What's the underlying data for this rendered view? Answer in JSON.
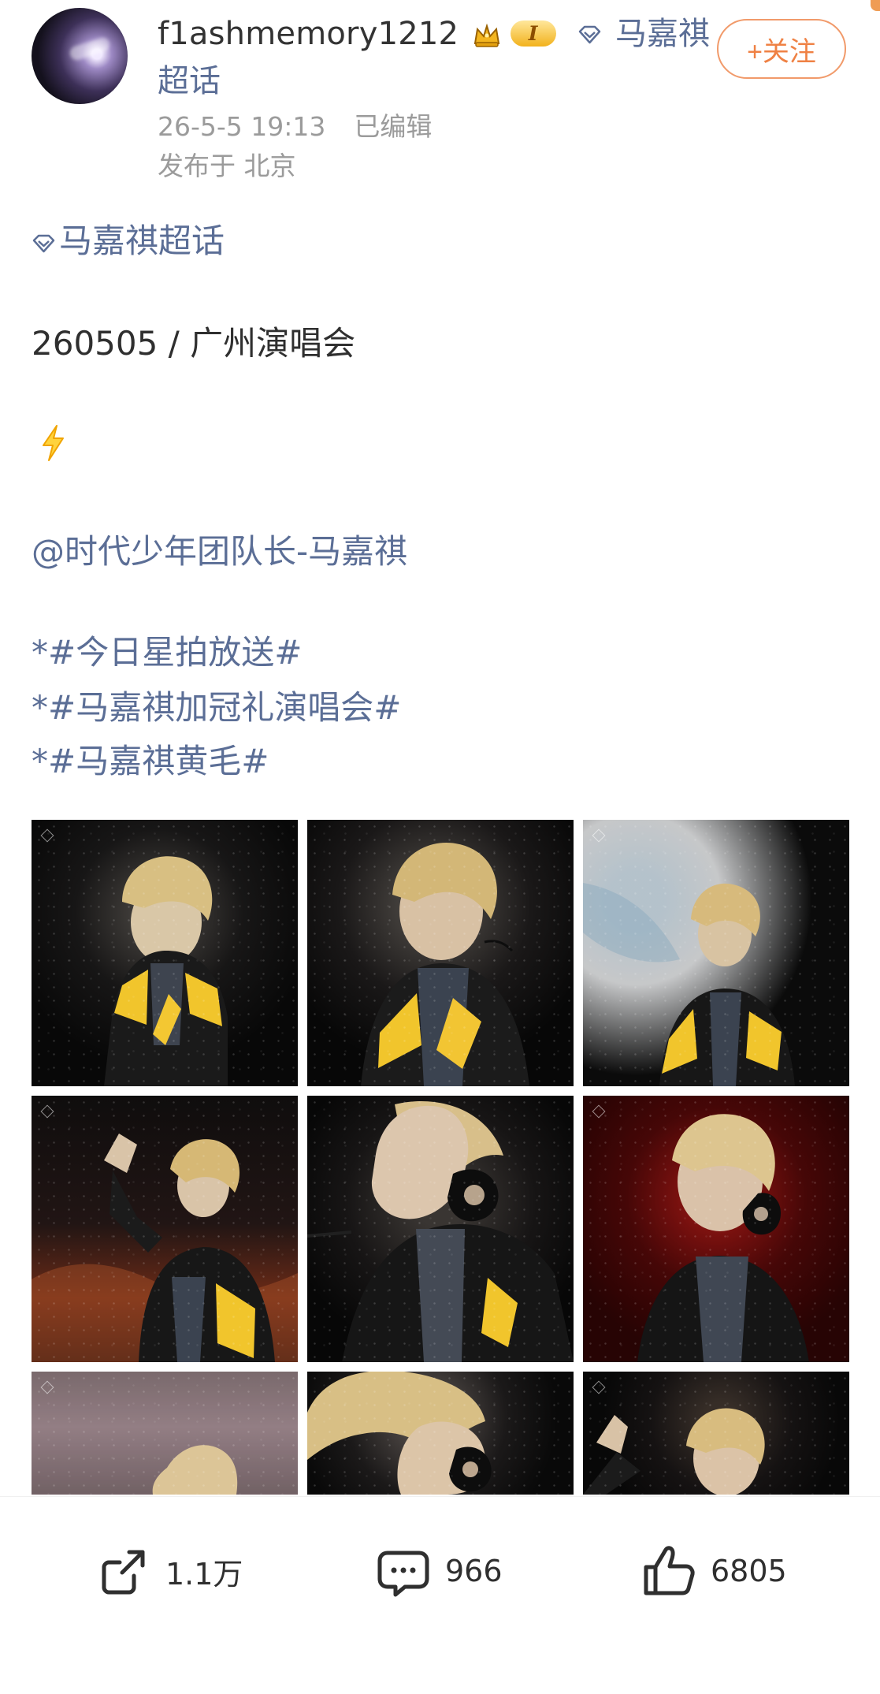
{
  "header": {
    "username": "f1ashmemory1212",
    "level_badge": "I",
    "supertopic_name_line1": "马嘉祺",
    "supertopic_name_line2": "超话",
    "follow_label": "+关注",
    "timestamp": "26-5-5 19:13",
    "edited_label": "已编辑",
    "location": "发布于 北京"
  },
  "post": {
    "topic": "马嘉祺超话",
    "date_line": "260505 / 广州演唱会",
    "emoji": "⚡",
    "mention": "@时代少年团队长-马嘉祺",
    "hashtags": [
      "*#今日星拍放送#",
      "*#马嘉祺加冠礼演唱会#",
      "*#马嘉祺黄毛#"
    ]
  },
  "images": {
    "count": 9
  },
  "actions": {
    "share_count": "1.1万",
    "comment_count": "966",
    "like_count": "6805"
  },
  "colors": {
    "link_blue": "#5b6e96",
    "follow_orange": "#ef8144",
    "meta_gray": "#9b9b9b",
    "gold_badge": "#f2b21d"
  },
  "icons": {
    "crown": "crown-icon",
    "supertopic": "diamond-icon",
    "share": "share-icon",
    "comment": "comment-icon",
    "like": "thumbs-up-icon",
    "lightning": "lightning-icon"
  }
}
